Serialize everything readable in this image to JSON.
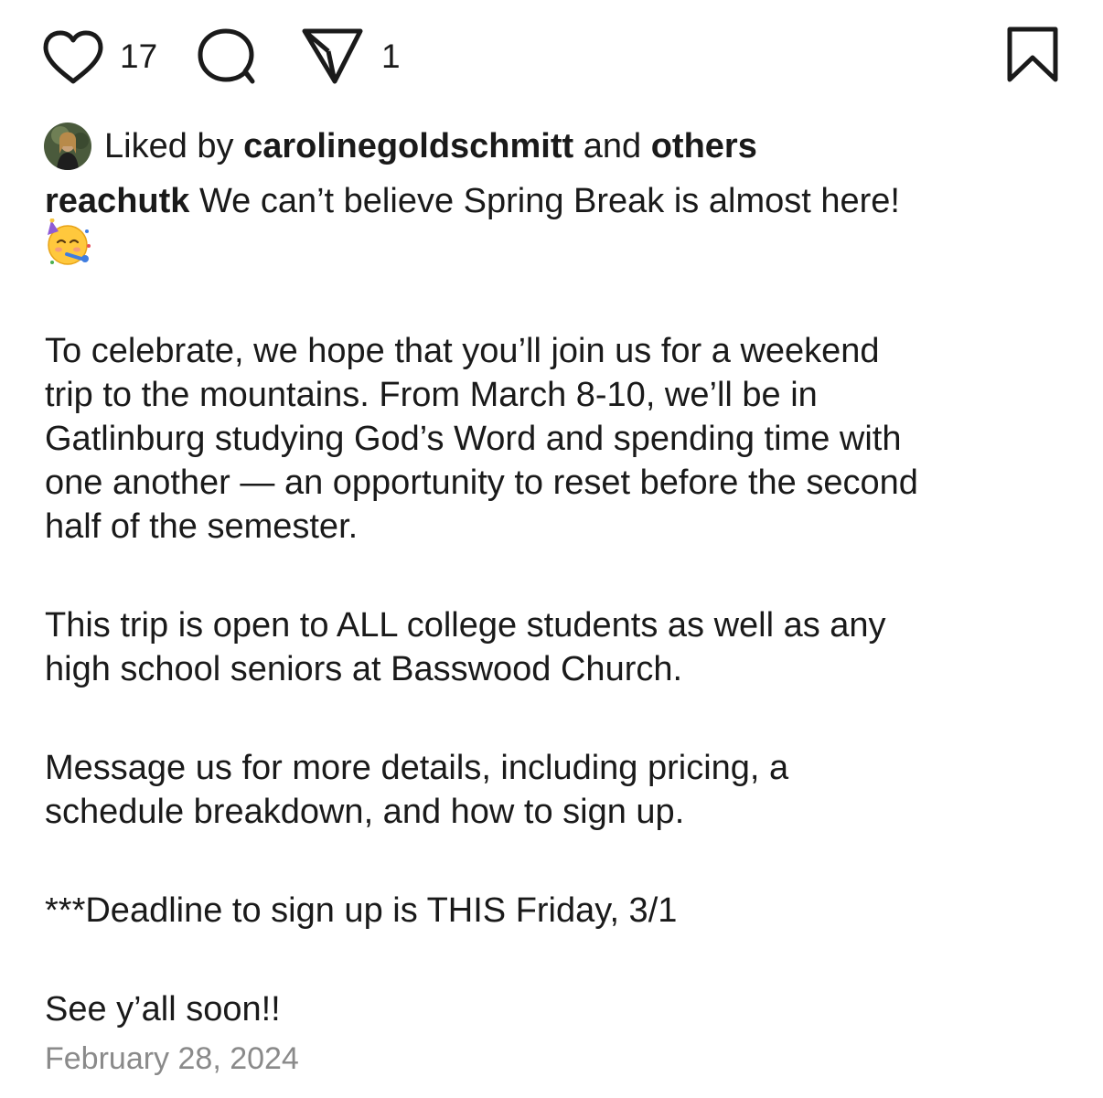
{
  "actions": {
    "like_count": "17",
    "share_count": "1",
    "icons": [
      "heart-icon",
      "comment-icon",
      "send-icon",
      "bookmark-icon"
    ]
  },
  "liked_by": {
    "prefix": "Liked by",
    "user": "carolinegoldschmitt",
    "conjunction": "and",
    "others": "others"
  },
  "post": {
    "username": "reachutk",
    "first_line": "We can’t believe Spring Break is almost here!",
    "emoji": "partying-face-icon",
    "paragraph_1_line_1": "To celebrate, we hope that you’ll join us for a weekend",
    "paragraph_1_line_2": "trip to the mountains. From March 8-10, we’ll be in",
    "paragraph_1_line_3": "Gatlinburg studying God’s Word and spending time with",
    "paragraph_1_line_4": "one another — an opportunity to reset before the second",
    "paragraph_1_line_5": "half of the semester.",
    "paragraph_2_line_1": "This trip is open to ALL college students as well as any",
    "paragraph_2_line_2": "high school seniors at Basswood Church.",
    "paragraph_3_line_1": "Message us for more details, including pricing, a",
    "paragraph_3_line_2": "schedule breakdown, and how to sign up.",
    "deadline": "***Deadline to sign up is THIS Friday, 3/1",
    "closing": "See y’all soon!!",
    "date": "February 28, 2024"
  },
  "colors": {
    "text": "#1a1a1a",
    "muted": "#8a8a8a",
    "background": "#ffffff"
  }
}
